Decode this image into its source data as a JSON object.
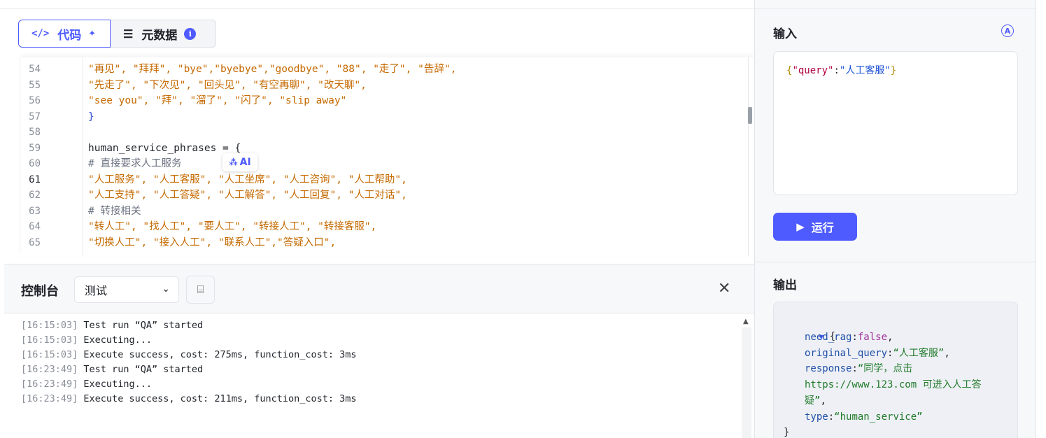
{
  "tabs": {
    "code": {
      "icon": "code-icon",
      "label": "代码"
    },
    "metadata": {
      "icon": "sliders-icon",
      "label": "元数据"
    }
  },
  "code": {
    "lines": [
      {
        "num": "54",
        "text": "\"再见\", \"拜拜\", \"bye\",\"byebye\",\"goodbye\", \"88\", \"走了\", \"告辞\",",
        "kind": "str"
      },
      {
        "num": "55",
        "text": "\"先走了\", \"下次见\", \"回头见\", \"有空再聊\", \"改天聊\",",
        "kind": "str"
      },
      {
        "num": "56",
        "text": "\"see you\", \"拜\", \"溜了\", \"闪了\", \"slip away\"",
        "kind": "str"
      },
      {
        "num": "57",
        "text": "}",
        "kind": "brace"
      },
      {
        "num": "58",
        "text": "",
        "kind": "plain"
      },
      {
        "num": "59",
        "text": "human_service_phrases = {",
        "kind": "plain"
      },
      {
        "num": "60",
        "text": "# 直接要求人工服务",
        "kind": "cmt"
      },
      {
        "num": "61",
        "text": "\"人工服务\", \"人工客服\", \"人工坐席\", \"人工咨询\", \"人工帮助\",",
        "kind": "str"
      },
      {
        "num": "62",
        "text": "\"人工支持\", \"人工答疑\", \"人工解答\", \"人工回复\", \"人工对话\",",
        "kind": "str"
      },
      {
        "num": "63",
        "text": "# 转接相关",
        "kind": "cmt"
      },
      {
        "num": "64",
        "text": "\"转人工\", \"找人工\", \"要人工\", \"转接人工\", \"转接客服\",",
        "kind": "str"
      },
      {
        "num": "65",
        "text": "\"切换人工\", \"接入人工\", \"联系人工\",\"答疑入口\",",
        "kind": "str"
      }
    ],
    "current_line": "61",
    "ai_badge": "AI"
  },
  "console": {
    "title": "控制台",
    "env_selected": "测试",
    "logs": [
      {
        "ts": "[16:15:03]",
        "msg": "Test run “QA” started"
      },
      {
        "ts": "[16:15:03]",
        "msg": "Executing..."
      },
      {
        "ts": "[16:15:03]",
        "msg": "Execute success, cost: 275ms, function_cost: 3ms"
      },
      {
        "ts": "[16:23:49]",
        "msg": "Test run “QA” started"
      },
      {
        "ts": "[16:23:49]",
        "msg": "Executing..."
      },
      {
        "ts": "[16:23:49]",
        "msg": "Execute success, cost: 211ms, function_cost: 3ms"
      }
    ]
  },
  "input": {
    "title": "输入",
    "json_key": "\"query\"",
    "json_value": "\"人工客服\""
  },
  "run_button": {
    "label": "运行"
  },
  "output": {
    "title": "输出",
    "need_rag_key": "need_rag",
    "need_rag_value": "false",
    "original_query_key": "original_query",
    "original_query_value": "“人工客服”",
    "response_key": "response",
    "response_value_line1": "“同学，点击",
    "response_value_line2": "https://www.123.com 可进入人工答",
    "response_value_line3": "疑”",
    "type_key": "type",
    "type_value": "“human_service”"
  },
  "colors": {
    "accent": "#4e5bff",
    "string": "#c56a00"
  }
}
